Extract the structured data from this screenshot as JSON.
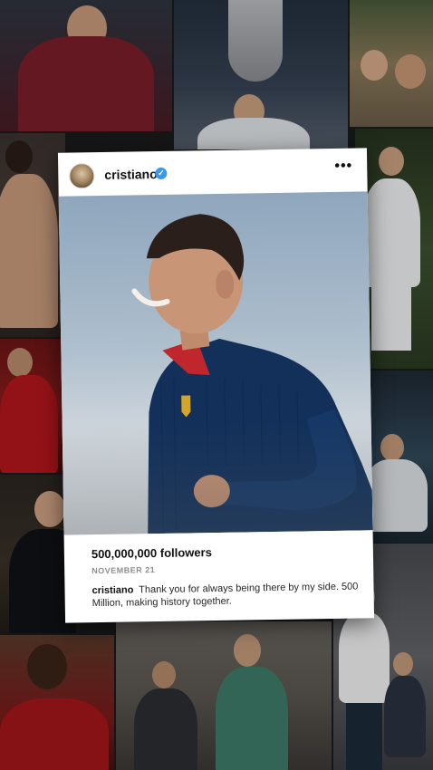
{
  "post": {
    "username": "cristiano",
    "verified": true,
    "more_menu": "•••",
    "stats": {
      "followers": "500,000,000 followers",
      "date": "NOVEMBER 21"
    },
    "caption": {
      "username": "cristiano",
      "text": "Thank you for always being there by my side. 500 Million, making history together."
    }
  },
  "icons": {
    "verified_badge": "verified-check-icon",
    "more": "more-options-icon"
  },
  "colors": {
    "accent_blue": "#3897f0",
    "jersey_navy": "#12305a",
    "collar_red": "#c0272d",
    "crest_gold": "#d4a52a"
  }
}
